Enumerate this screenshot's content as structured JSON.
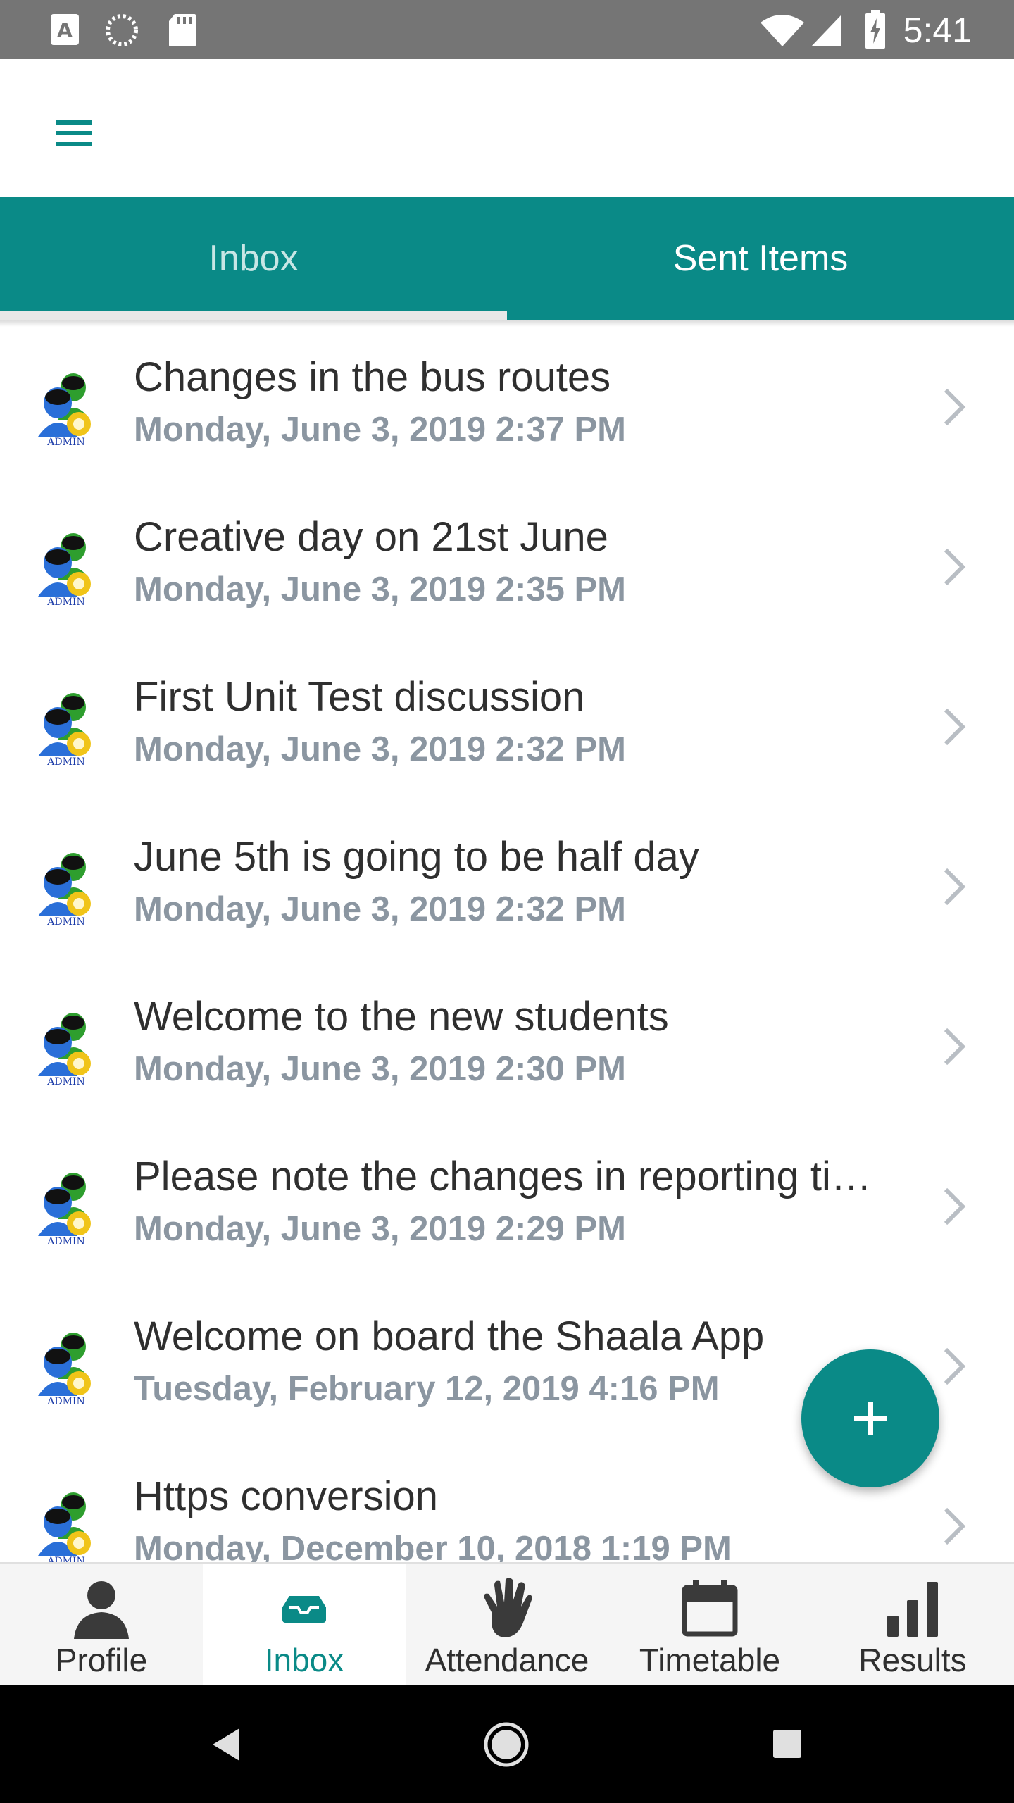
{
  "status_bar": {
    "time": "5:41",
    "icons": [
      "a-icon",
      "loading-icon",
      "sd-card-icon",
      "wifi-icon",
      "signal-icon",
      "battery-charging-icon"
    ]
  },
  "app_bar": {
    "menu_icon": "hamburger-menu-icon"
  },
  "tabs": [
    {
      "label": "Inbox",
      "active": true
    },
    {
      "label": "Sent Items",
      "active": false
    }
  ],
  "messages": [
    {
      "title": "Changes in the bus routes",
      "date": "Monday, June 3, 2019 2:37 PM",
      "sender_icon": "admin-avatar-icon"
    },
    {
      "title": "Creative day on 21st June",
      "date": "Monday, June 3, 2019 2:35 PM",
      "sender_icon": "admin-avatar-icon"
    },
    {
      "title": "First Unit Test discussion",
      "date": "Monday, June 3, 2019 2:32 PM",
      "sender_icon": "admin-avatar-icon"
    },
    {
      "title": "June 5th is going to be half day",
      "date": "Monday, June 3, 2019 2:32 PM",
      "sender_icon": "admin-avatar-icon"
    },
    {
      "title": "Welcome to the new students",
      "date": "Monday, June 3, 2019 2:30 PM",
      "sender_icon": "admin-avatar-icon"
    },
    {
      "title": "Please note the changes in reporting ti…",
      "date": "Monday, June 3, 2019 2:29 PM",
      "sender_icon": "admin-avatar-icon"
    },
    {
      "title": "Welcome on board the Shaala App",
      "date": "Tuesday, February 12, 2019 4:16 PM",
      "sender_icon": "admin-avatar-icon"
    },
    {
      "title": "Https conversion",
      "date": "Monday, December 10, 2018 1:19 PM",
      "sender_icon": "admin-avatar-icon"
    }
  ],
  "avatar_badge": "ADMIN",
  "fab": {
    "label": "+",
    "icon": "add-icon"
  },
  "bottom_nav": [
    {
      "label": "Profile",
      "icon": "person-icon",
      "active": false
    },
    {
      "label": "Inbox",
      "icon": "inbox-tray-icon",
      "active": true
    },
    {
      "label": "Attendance",
      "icon": "hand-icon",
      "active": false
    },
    {
      "label": "Timetable",
      "icon": "calendar-icon",
      "active": false
    },
    {
      "label": "Results",
      "icon": "bar-chart-icon",
      "active": false
    }
  ],
  "colors": {
    "primary": "#0a8a87",
    "date_text": "#8b96a1",
    "title_text": "#2f2f2f",
    "status_bar": "#757575"
  }
}
